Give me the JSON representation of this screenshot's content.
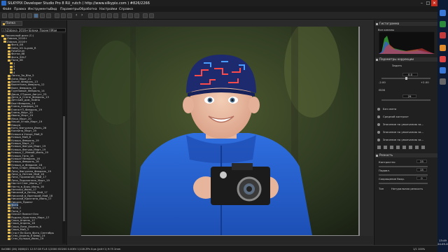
{
  "window": {
    "title": "SILKYPIX Developer Studio Pro 8 RU_rutch ( http://www.silkypix.com )  #826/2266"
  },
  "menu": [
    "Файл",
    "Правка",
    "Инструменты",
    "Вид",
    "Параметры",
    "Обработка",
    "Настройки",
    "Справка"
  ],
  "left_panel": {
    "tab_label": "Папка",
    "path": "(:)\\Zabava_2016+\\Блоки_Проект\\Мая",
    "tree": [
      "Локальный диск (C:)",
      "Zabava_2016+",
      "Zabava_2016+",
      "Фото_08",
      "Gella_VG A-grab_R",
      "Fotoforum",
      "Фотки_88",
      "Фото_SHLF",
      "Пола_08",
      "1",
      "2",
      "3",
      "4",
      "Лента_Зи_Bha_5",
      "Анна_Март_21",
      "Вален_Февраль_13",
      "Валентина_Февраль_12",
      "Вале_Февраль_15",
      "Групповые_Февраль_14",
      "Даша_ОТдыхе_Август_25",
      "Дети_в_Стене_Февраль_13",
      "Детский_дом_Лайна",
      "Ева+Февраль_14",
      "Елена_Алифера_19",
      "Елена+П_Февраль_19",
      "Елена_Март_20",
      "Ивана_Март_19",
      "Ильи_Март_20",
      "Ильян_Углов_Март_19",
      "Кашуя",
      "Катя_Фигурная_Июнь_26",
      "Калеина_Март_19",
      "Ксюша в Улице_Май_8",
      "Ксюша_Май_6",
      "Ксюша_Февраль_19",
      "Ксюша_Март_12",
      "Ксюша_Фигура_Март_19",
      "Ксюша_Фигура_Март_19",
      "Ксюша_С_Мамой_Июнь_19",
      "Ксюша_Танк_18",
      "Ксюша+Февраль_16",
      "Ксюша_Февраль_16",
      "Ксюша_и_Феврале_16",
      "Лиза_Спорт_Февраль_17",
      "Лиза_Фигурная_Февраль_19",
      "Лиза_в_Летнее_Май_16",
      "Лиза_Торомание_Май_17",
      "Лиза_Подоконник_Март_19",
      "Настя+Снег_Июнь_17",
      "Настя_в_Бору_Июнь_16",
      "Наталья_Июнь_17",
      "Николай_в_Ветер_Май_17",
      "Николай_в_Вратарий_Май_18",
      "Николай_Кристина_Июнь_17",
      "Никола_Проект",
      "Фото",
      "Поля_1",
      "Поля_2",
      "Олеся+Лиена+Оля",
      "Родина_Кристина_Март_17",
      "Саша_Апрель_17",
      "Саша_Апрель_18",
      "Саша_Лиза_Апрель_6",
      "Саша_Май_3",
      "Стас+Ле Бога_Фото_Сентябрь",
      "Стек_Апрель_6 Февр_19",
      "Стек_Кульша_Июнь_19"
    ]
  },
  "right_panel": {
    "histogram_title": "Гистограмма",
    "histogram_mode": "Все каналы",
    "correction_title": "Параметры коррекции",
    "preset_label": "Задать",
    "exposure_value": "0.0",
    "exposure_min": "-2.00",
    "exposure_max": "+2.00",
    "iso_label": "ISO6",
    "iso_value": "29",
    "rows": [
      "Без света",
      "Средний контраст",
      "Значение по умолчанию за...",
      "Значение по умолчанию за...",
      "Значение по умолчанию за..."
    ],
    "sharpness_title": "Резкость",
    "contrast_label": "Контрастно",
    "contrast_value": "25",
    "detail_label": "Подавл.",
    "detail_value": "15",
    "color_label": "Сокращение бахр.",
    "color_value": "0",
    "type_label": "Тип",
    "type_value": "Натуральная резкость"
  },
  "status": {
    "left": "0x0080 (26) 16/08/21 12:37:28 F1.8 1/2000 ISO200 0.00EV 1/128 ZPn 0:ps |(alt+1) 9:75 2mm",
    "right": "1/1 100%"
  },
  "clock": {
    "time": "13:49",
    "date": "24.05.2017"
  },
  "colors": {
    "accent": "#2a6bc8",
    "selection": "#2f4a6b",
    "close": "#c42b1c"
  },
  "icons": [
    "app-icon",
    "folder-icon",
    "minimize-icon",
    "maximize-icon",
    "close-icon",
    "open-icon",
    "save-icon",
    "rotate-left-icon",
    "rotate-right-icon",
    "compare-icon",
    "zoom-icon",
    "grid-icon",
    "histogram-icon",
    "settings-icon"
  ]
}
